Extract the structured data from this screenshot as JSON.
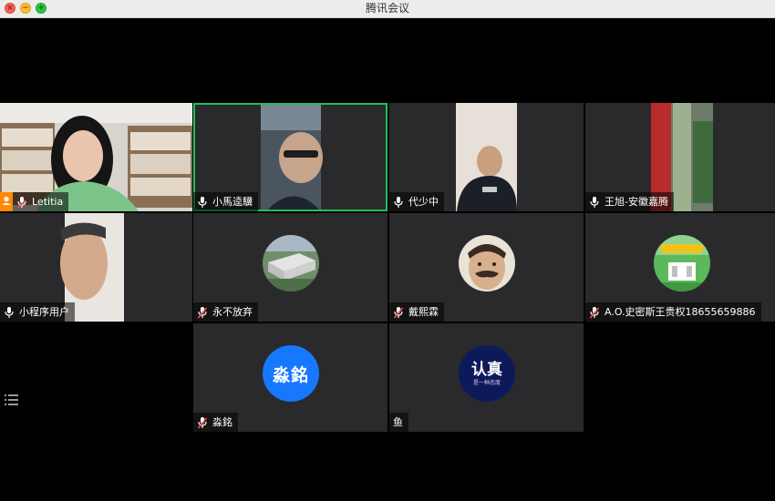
{
  "window": {
    "title": "腾讯会议"
  },
  "participants": [
    {
      "name": "Letitia",
      "mic": "on",
      "host": true
    },
    {
      "name": "小馬逵驥",
      "mic": "on",
      "active": true
    },
    {
      "name": "代少中",
      "mic": "on"
    },
    {
      "name": "王旭-安徽嘉腾",
      "mic": "on"
    },
    {
      "name": "小程序用户",
      "mic": "on"
    },
    {
      "name": "永不放弃",
      "mic": "muted"
    },
    {
      "name": "戴熙霖",
      "mic": "muted"
    },
    {
      "name": "A.O.史密斯王贵权18655659886",
      "mic": "muted"
    },
    {
      "name": "淼銘",
      "mic": "muted",
      "avatar_text": "淼銘"
    },
    {
      "name": "鱼",
      "mic": "none",
      "avatar_lines": [
        "认真",
        "是一种态度"
      ]
    }
  ],
  "colors": {
    "active_border": "#1ec05b",
    "tile_bg": "#2a2a2c",
    "host_badge": "#ff8a00",
    "avatar_blue": "#1677ff"
  }
}
